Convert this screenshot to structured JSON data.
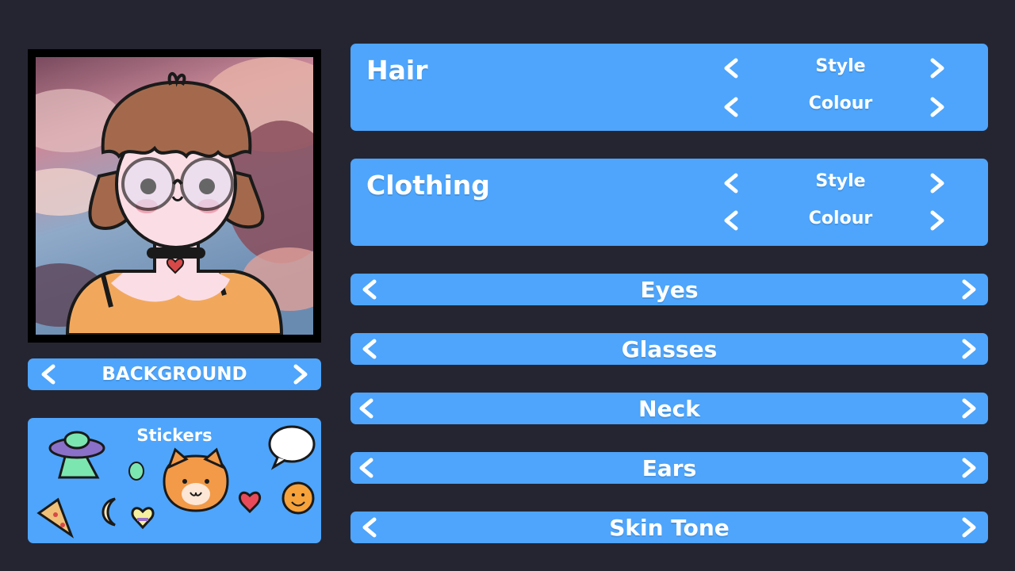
{
  "background_selector": {
    "label": "BACKGROUND"
  },
  "stickers": {
    "title": "Stickers"
  },
  "hair": {
    "title": "Hair",
    "style_label": "Style",
    "colour_label": "Colour"
  },
  "clothing": {
    "title": "Clothing",
    "style_label": "Style",
    "colour_label": "Colour"
  },
  "bars": {
    "eyes": "Eyes",
    "glasses": "Glasses",
    "neck": "Neck",
    "ears": "Ears",
    "skin_tone": "Skin Tone"
  },
  "icons": {
    "prev": "chevron-left-icon",
    "next": "chevron-right-icon"
  },
  "colors": {
    "page_background": "#252532",
    "panel_blue": "#4ea5fb",
    "text": "#ffffff",
    "hair": "#a4694c",
    "shirt": "#f2a85c"
  }
}
